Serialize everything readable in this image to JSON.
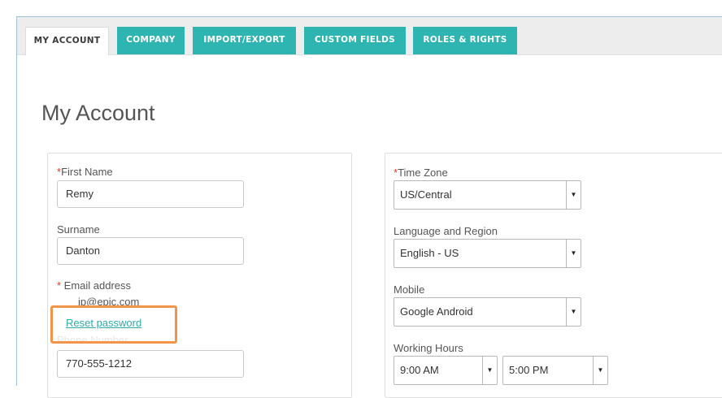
{
  "tabs": [
    {
      "label": "MY ACCOUNT",
      "active": true
    },
    {
      "label": "COMPANY",
      "active": false
    },
    {
      "label": "IMPORT/EXPORT",
      "active": false
    },
    {
      "label": "CUSTOM FIELDS",
      "active": false
    },
    {
      "label": "ROLES & RIGHTS",
      "active": false
    }
  ],
  "page": {
    "title": "My Account"
  },
  "left": {
    "first_name": {
      "required": "*",
      "label": "First Name",
      "value": "Remy"
    },
    "surname": {
      "label": "Surname",
      "value": "Danton"
    },
    "email": {
      "required": "* ",
      "label": "Email address",
      "value": "jp@epic.com"
    },
    "reset_password": "Reset password",
    "phone": {
      "label": "Phone Number",
      "value": "770-555-1212"
    }
  },
  "right": {
    "time_zone": {
      "required": "*",
      "label": "Time Zone",
      "value": "US/Central"
    },
    "language": {
      "label": "Language and Region",
      "value": "English - US"
    },
    "mobile": {
      "label": "Mobile",
      "value": "Google Android"
    },
    "working_hours": {
      "label": "Working Hours",
      "start": "9:00 AM",
      "end": "5:00 PM"
    }
  },
  "colors": {
    "tab_teal": "#2fb5b1",
    "link": "#2fa9a9",
    "highlight": "#f0954a",
    "required": "#d9412d"
  }
}
